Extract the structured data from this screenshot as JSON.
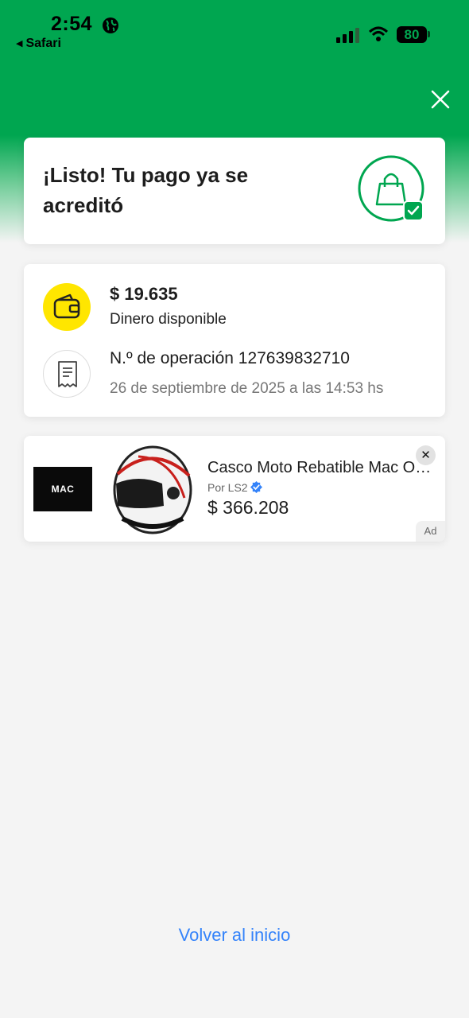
{
  "status_bar": {
    "time": "2:54",
    "back_app": "Safari",
    "battery": "80"
  },
  "icons": {
    "close": "close-icon",
    "bag_check": "shopping-bag-check-icon",
    "wallet": "wallet-icon",
    "receipt": "receipt-icon",
    "verified": "verified-badge-icon"
  },
  "colors": {
    "brand_green": "#00a650",
    "wallet_yellow": "#ffe600",
    "link_blue": "#3483fa",
    "verified_blue": "#3483fa"
  },
  "success": {
    "title": "¡Listo! Tu pago ya se acreditó"
  },
  "details": {
    "amount": "$ 19.635",
    "amount_label": "Dinero disponible",
    "operation": "N.º de operación 127639832710",
    "date": "26 de septiembre de 2025 a las 14:53 hs"
  },
  "ad": {
    "brand": "MAC",
    "title": "Casco Moto Rebatible Mac Octane",
    "seller": "Por LS2",
    "price": "$ 366.208",
    "badge": "Ad",
    "close": "✕"
  },
  "footer": {
    "back_home": "Volver al inicio"
  }
}
